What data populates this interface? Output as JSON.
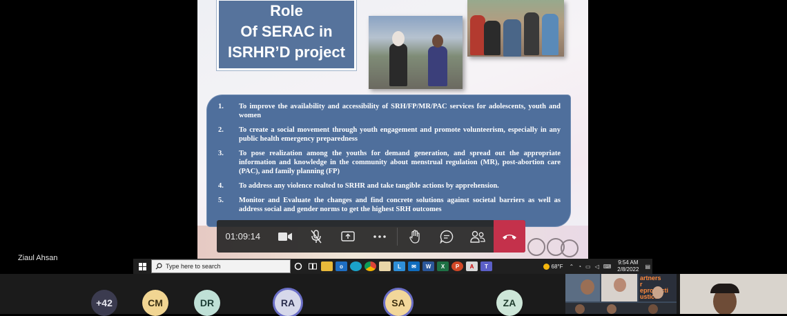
{
  "slide": {
    "title_lines": [
      "Role",
      "Of SERAC in",
      "ISRHR’D project"
    ],
    "items": [
      {
        "num": "1.",
        "text": "To improve the availability and accessibility of SRH/FP/MR/PAC services for adolescents, youth and women"
      },
      {
        "num": "2.",
        "text": "To create a social movement through youth engagement and promote volunteerism, especially in any public health emergency preparedness"
      },
      {
        "num": "3.",
        "text": "To pose realization among the youths for demand generation, and spread out the appropriate information and knowledge in the community about menstrual regulation (MR), post-abortion care (PAC), and family planning (FP)"
      },
      {
        "num": "4.",
        "text": "To address any violence realted to SRHR and take tangible actions by apprehension."
      },
      {
        "num": "5.",
        "text": "Monitor and Evaluate the changes and find concrete solutions against societal barriers as well as address social and gender norms to get the highest SRH outcomes"
      }
    ]
  },
  "controls": {
    "timer": "01:09:14",
    "icons": [
      "camera-icon",
      "mic-off-icon",
      "share-screen-icon",
      "more-icon",
      "raise-hand-icon",
      "chat-icon",
      "participants-icon",
      "hang-up-icon"
    ]
  },
  "presenter_label": "Ziaul Ahsan",
  "taskbar": {
    "search_placeholder": "Type here to search",
    "weather": "68°F",
    "time": "9:54 AM",
    "date": "2/8/2022"
  },
  "participants": [
    {
      "initials": "+42",
      "bg": "#3b3b4f",
      "fg": "#e8e8f0",
      "active": false
    },
    {
      "initials": "CM",
      "bg": "#f1d592",
      "fg": "#3a2f12",
      "active": false
    },
    {
      "initials": "DR",
      "bg": "#bfe0d6",
      "fg": "#1d3d35",
      "active": false
    },
    {
      "initials": "RA",
      "bg": "#d6d8ea",
      "fg": "#2c2f4f",
      "active": true
    },
    {
      "initials": "SA",
      "bg": "#f2d79a",
      "fg": "#3d2f10",
      "active": true
    },
    {
      "initials": "ZA",
      "bg": "#cde6d8",
      "fg": "#1e3b2c",
      "active": false
    }
  ],
  "video_tile_text": "artners\nr\neproducti\nustice",
  "colors": {
    "slide_panel": "#4f6f9c",
    "hangup": "#c4314b",
    "active_ring": "#6b6fc7"
  }
}
